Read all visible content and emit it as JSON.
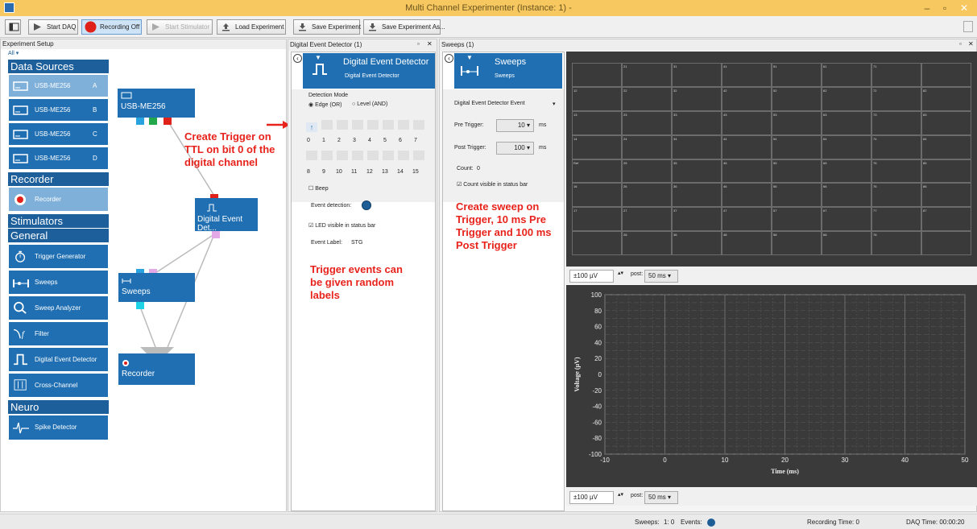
{
  "window": {
    "title": "Multi Channel Experimenter (Instance: 1) -"
  },
  "toolbar": {
    "start_daq": "Start DAQ",
    "recording": "Recording Off",
    "start_stimulator": "Start Stimulator",
    "load": "Load Experiment",
    "save": "Save Experiment",
    "save_as": "Save Experiment As..."
  },
  "setup": {
    "title": "Experiment Setup",
    "filter": "All",
    "categories": {
      "data_sources": "Data Sources",
      "recorder": "Recorder",
      "stimulators": "Stimulators",
      "general": "General",
      "neuro": "Neuro"
    },
    "sources": [
      {
        "name": "USB-ME256",
        "ch": "A"
      },
      {
        "name": "USB-ME256",
        "ch": "B"
      },
      {
        "name": "USB-ME256",
        "ch": "C"
      },
      {
        "name": "USB-ME256",
        "ch": "D"
      }
    ],
    "recorder_item": "Recorder",
    "general_items": [
      "Trigger Generator",
      "Sweeps",
      "Sweep Analyzer",
      "Filter",
      "Digital Event Detector",
      "Cross-Channel"
    ],
    "neuro_items": [
      "Spike Detector"
    ]
  },
  "canvas": {
    "nodes": {
      "usb": "USB-ME256",
      "ded": "Digital Event Det...",
      "sweeps": "Sweeps",
      "recorder": "Recorder"
    },
    "annotation1": "Create Trigger on TTL on bit 0 of the digital channel"
  },
  "ded_panel": {
    "title": "Digital Event Detector (1)",
    "header_title": "Digital Event Detector",
    "header_sub": "Digital Event Detector",
    "mode_label": "Detection Mode",
    "mode_edge": "Edge (OR)",
    "mode_level": "Level (AND)",
    "bits_row1": [
      "0",
      "1",
      "2",
      "3",
      "4",
      "5",
      "6",
      "7"
    ],
    "bits_row2": [
      "8",
      "9",
      "10",
      "11",
      "12",
      "13",
      "14",
      "15"
    ],
    "beep": "Beep",
    "event_detection": "Event detection:",
    "led": "LED visible in status bar",
    "event_label": "Event Label:",
    "event_label_value": "STG",
    "annotation": "Trigger events can be given random labels"
  },
  "sweeps_panel": {
    "title": "Sweeps (1)",
    "header_title": "Sweeps",
    "header_sub": "Sweeps",
    "trigger_source": "Digital Event Detector Event",
    "pre_trigger": "Pre Trigger:",
    "pre_value": "10",
    "post_trigger": "Post Trigger:",
    "post_value": "100",
    "unit": "ms",
    "count_label": "Count:",
    "count_value": "0",
    "count_visible": "Count visible in status bar",
    "annotation": "Create sweep on Trigger, 10 ms Pre Trigger and 100 ms Post Trigger",
    "grid_rows": [
      [
        "",
        "21",
        "31",
        "41",
        "51",
        "61",
        "71",
        ""
      ],
      [
        "12",
        "22",
        "32",
        "42",
        "52",
        "62",
        "72",
        "82"
      ],
      [
        "13",
        "23",
        "33",
        "43",
        "53",
        "63",
        "73",
        "83"
      ],
      [
        "14",
        "24",
        "34",
        "44",
        "54",
        "64",
        "74",
        "84"
      ],
      [
        "Ref",
        "25",
        "35",
        "45",
        "55",
        "65",
        "75",
        "85"
      ],
      [
        "16",
        "26",
        "36",
        "46",
        "56",
        "66",
        "76",
        "86"
      ],
      [
        "17",
        "27",
        "37",
        "47",
        "57",
        "67",
        "77",
        "87"
      ],
      [
        "",
        "28",
        "38",
        "48",
        "58",
        "68",
        "78",
        ""
      ]
    ],
    "scale": "±100 µV",
    "post_label": "post:",
    "time_window": "50 ms"
  },
  "chart_data": {
    "type": "line",
    "xlabel": "Time (ms)",
    "ylabel": "Voltage (µV)",
    "xlim": [
      -10,
      50
    ],
    "ylim": [
      -100,
      100
    ],
    "xticks": [
      -10,
      0,
      10,
      20,
      30,
      40,
      50
    ],
    "yticks": [
      100,
      80,
      60,
      40,
      20,
      0,
      -20,
      -40,
      -60,
      -80,
      -100
    ],
    "grid": true,
    "series": []
  },
  "status": {
    "sweeps": "Sweeps:",
    "sweeps_value": "1: 0",
    "events": "Events:",
    "recording_time": "Recording Time: 0",
    "daq_time": "DAQ Time: 00:00:20"
  },
  "colors": {
    "accent": "#1f6fb2",
    "title_bar": "#f6c85f",
    "annotation": "#e8231c",
    "plot_bg": "#3a3a3a"
  }
}
